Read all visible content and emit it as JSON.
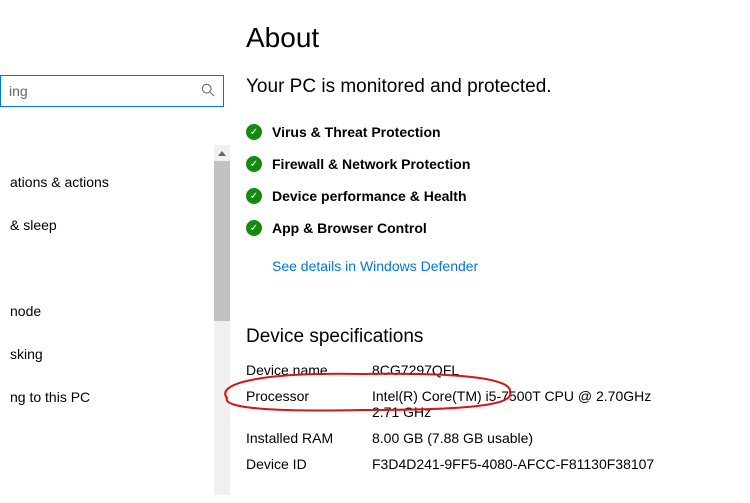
{
  "page": {
    "title": "About",
    "status": "Your PC is monitored and protected."
  },
  "search": {
    "value": "ing"
  },
  "sidebar": {
    "items": [
      {
        "label": "ations & actions"
      },
      {
        "label": "& sleep"
      },
      {
        "label": ""
      },
      {
        "label": "node"
      },
      {
        "label": "sking"
      },
      {
        "label": "ng to this PC"
      }
    ]
  },
  "protection": {
    "items": [
      {
        "label": "Virus & Threat Protection"
      },
      {
        "label": "Firewall & Network Protection"
      },
      {
        "label": "Device performance & Health"
      },
      {
        "label": "App & Browser Control"
      }
    ],
    "link": "See details in Windows Defender"
  },
  "specs": {
    "title": "Device specifications",
    "rows": [
      {
        "label": "Device name",
        "value": "8CG7297QFL"
      },
      {
        "label": "Processor",
        "value": "Intel(R) Core(TM) i5-7500T CPU @ 2.70GHz   2.71 GHz"
      },
      {
        "label": "Installed RAM",
        "value": "8.00 GB (7.88 GB usable)"
      },
      {
        "label": "Device ID",
        "value": "F3D4D241-9FF5-4080-AFCC-F81130F38107"
      }
    ]
  }
}
